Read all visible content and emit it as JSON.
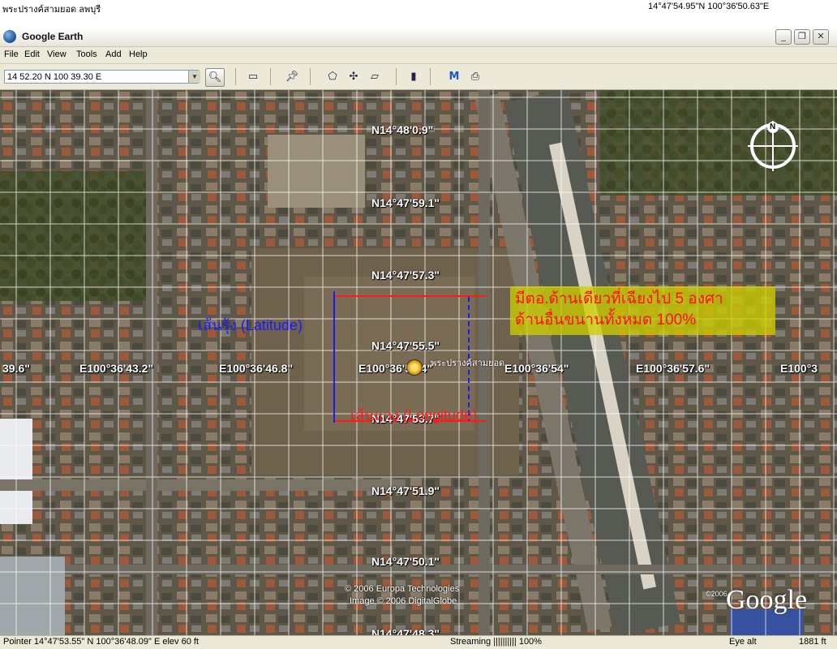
{
  "caption": {
    "left_text": "พระปรางค์สามยอด ลพบุรี",
    "right_text": "14°47'54.95\"N  100°36'50.63\"E"
  },
  "window": {
    "title": "Google Earth",
    "buttons": [
      "_",
      "❐",
      "✕"
    ]
  },
  "menu": [
    "File",
    "Edit",
    "View",
    "Tools",
    "Add",
    "Help"
  ],
  "toolbar": {
    "search_value": "14 52.20 N 100 39.30 E"
  },
  "map": {
    "lat_labels": [
      "N14°48'0.9\"",
      "N14°47'59.1\"",
      "N14°47'57.3\"",
      "N14°47'55.5\"",
      "N14°47'53.7\"",
      "N14°47'51.9\"",
      "N14°47'50.1\"",
      "N14°47'48.3\""
    ],
    "lon_labels": [
      "39.6\"",
      "E100°36'43.2\"",
      "E100°36'46.8\"",
      "E100°36'50.4\"",
      "E100°36'54\"",
      "E100°36'57.6\"",
      "E100°3"
    ],
    "placemark": "พระปรางค์สามยอด",
    "annotation_latitude": "เส้นรุ้ง (Latitude)",
    "annotation_longitude": "เส้นแวง (Longitude)",
    "callout_line1": "มีตอ.ด้านเดียวที่เฉียงไป 5 องศา",
    "callout_line2": "ด้านอื่นขนานทั้งหมด 100%",
    "copyright1": "© 2006 Europa Technologies",
    "copyright2": "Image © 2006 DigitalGlobe",
    "small_year": "©2006",
    "google": "Google",
    "compass": "N"
  },
  "status": {
    "pointer": "Pointer 14°47'53.55\"  N   100°36'48.09\"  E     elev    60 ft",
    "streaming": "Streaming |||||||||| 100%",
    "eye_alt_label": "Eye alt",
    "eye_alt_value": "1881 ft"
  }
}
